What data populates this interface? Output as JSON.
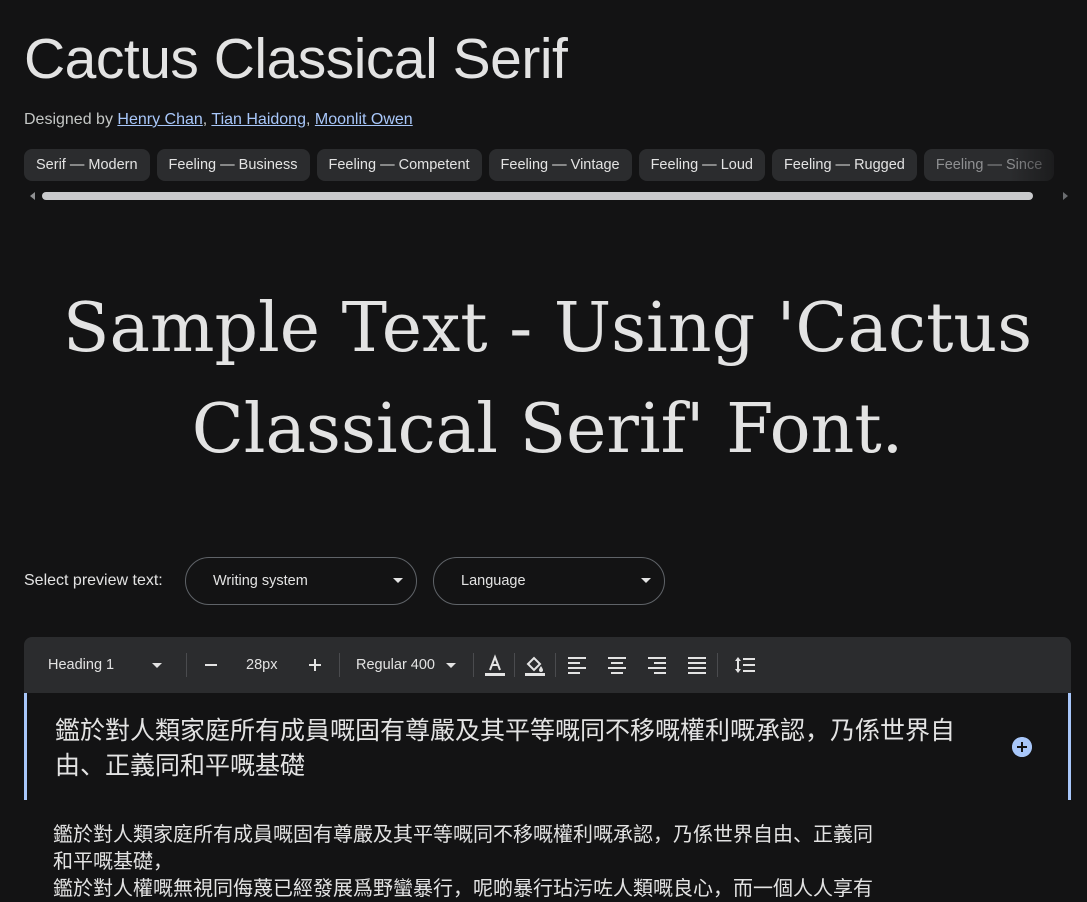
{
  "font": {
    "name": "Cactus Classical Serif",
    "designed_by_label": "Designed by",
    "designers": [
      "Henry Chan",
      "Tian Haidong",
      "Moonlit Owen"
    ]
  },
  "tags": [
    "Serif — Modern",
    "Feeling — Business",
    "Feeling — Competent",
    "Feeling — Vintage",
    "Feeling — Loud",
    "Feeling — Rugged",
    "Feeling — Since"
  ],
  "sample": {
    "line1": "Sample Text - Using 'Cactus",
    "line2": "Classical Serif' Font."
  },
  "preview": {
    "label": "Select preview text:",
    "writing_system": "Writing system",
    "language": "Language"
  },
  "toolbar": {
    "style": "Heading 1",
    "size": "28px",
    "weight": "Regular 400"
  },
  "content": {
    "heading": "鑑於對人類家庭所有成員嘅固有尊嚴及其平等嘅同不移嘅權利嘅承認，乃係世界自由、正義同和平嘅基礎",
    "paragraph_line1": "鑑於對人類家庭所有成員嘅固有尊嚴及其平等嘅同不移嘅權利嘅承認，乃係世界自由、正義同",
    "paragraph_line2": "和平嘅基礎，",
    "paragraph_line3": "鑑於對人權嘅無視同侮蔑已經發展爲野蠻暴行，呢啲暴行玷污咗人類嘅良心，而一個人人享有"
  },
  "colors": {
    "background": "#131314",
    "chip": "#2b2c2e",
    "accent": "#a8c7fa",
    "text": "#e3e3e3"
  }
}
